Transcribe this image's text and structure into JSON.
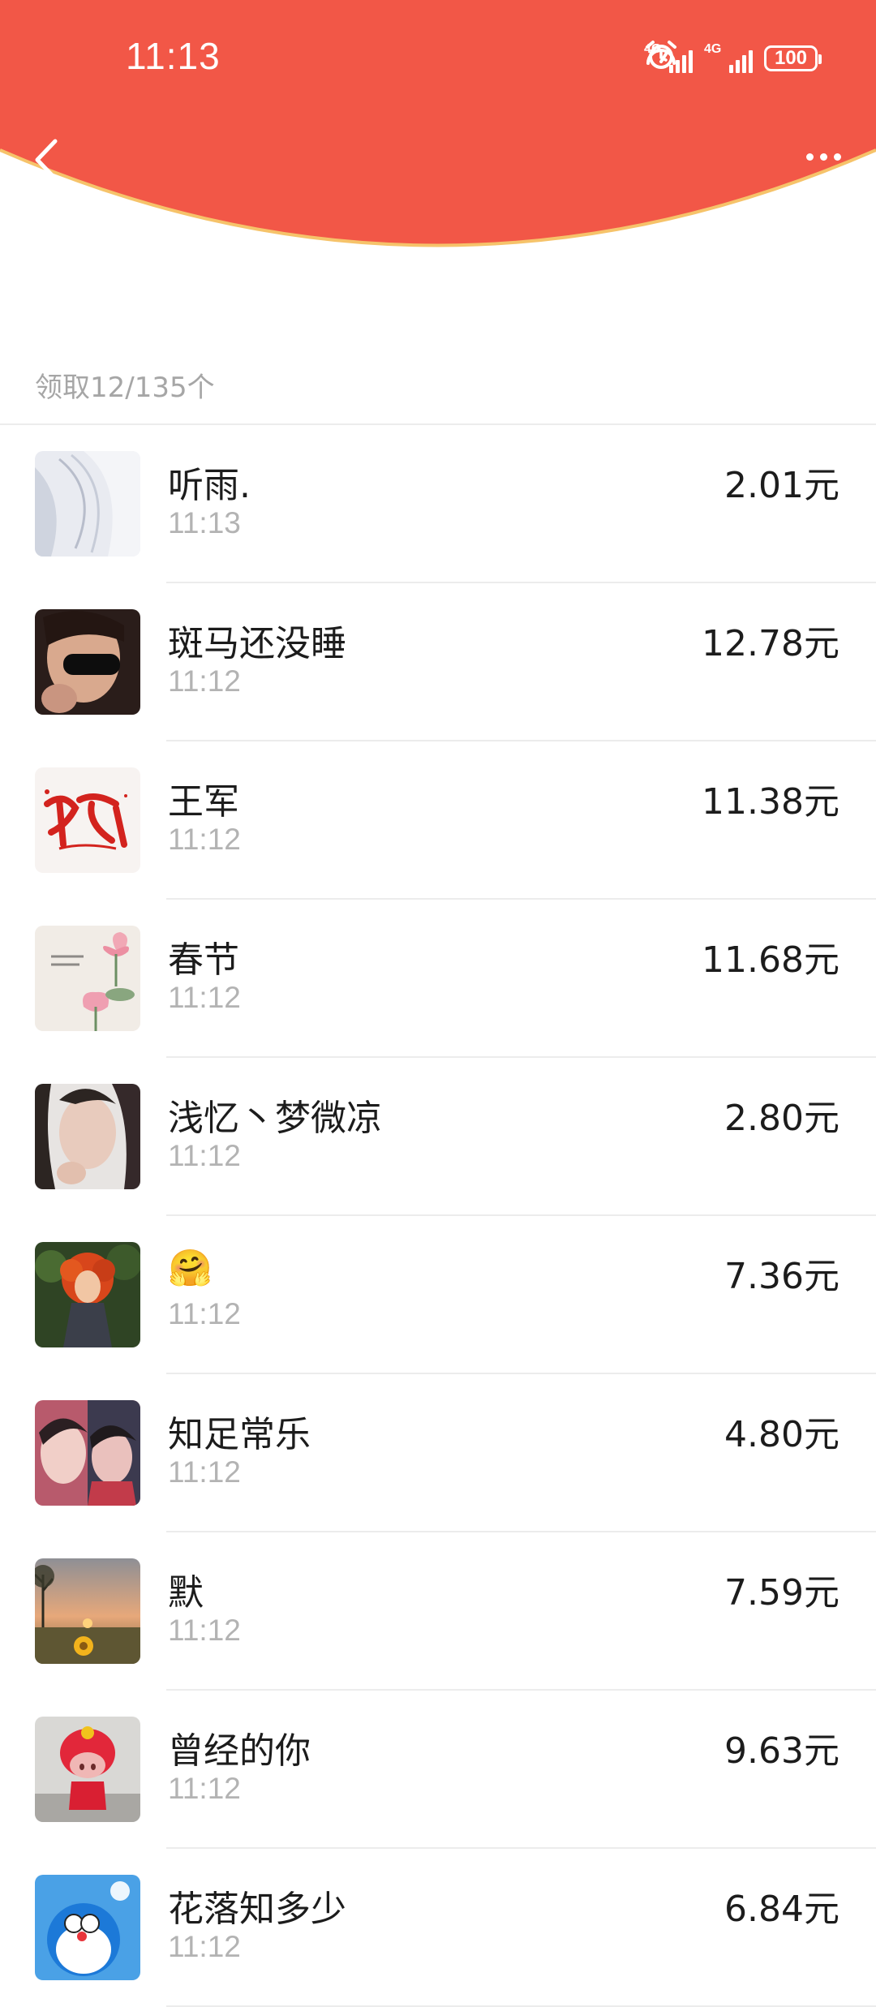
{
  "status_bar": {
    "time": "11:13",
    "network1": "4G",
    "network2": "4G",
    "battery": "100"
  },
  "colors": {
    "header": "#f25747",
    "header_edge": "#f6c36a"
  },
  "summary": "领取12/135个",
  "list": [
    {
      "name": "听雨.",
      "time": "11:13",
      "amount": "2.01元"
    },
    {
      "name": "斑马还没睡",
      "time": "11:12",
      "amount": "12.78元"
    },
    {
      "name": "王军",
      "time": "11:12",
      "amount": "11.38元"
    },
    {
      "name": "春节",
      "time": "11:12",
      "amount": "11.68元"
    },
    {
      "name": "浅忆丶梦微凉",
      "time": "11:12",
      "amount": "2.80元"
    },
    {
      "name": "🤗",
      "time": "11:12",
      "amount": "7.36元"
    },
    {
      "name": "知足常乐",
      "time": "11:12",
      "amount": "4.80元"
    },
    {
      "name": "默",
      "time": "11:12",
      "amount": "7.59元"
    },
    {
      "name": "曾经的你",
      "time": "11:12",
      "amount": "9.63元"
    },
    {
      "name": "花落知多少",
      "time": "11:12",
      "amount": "6.84元"
    }
  ]
}
